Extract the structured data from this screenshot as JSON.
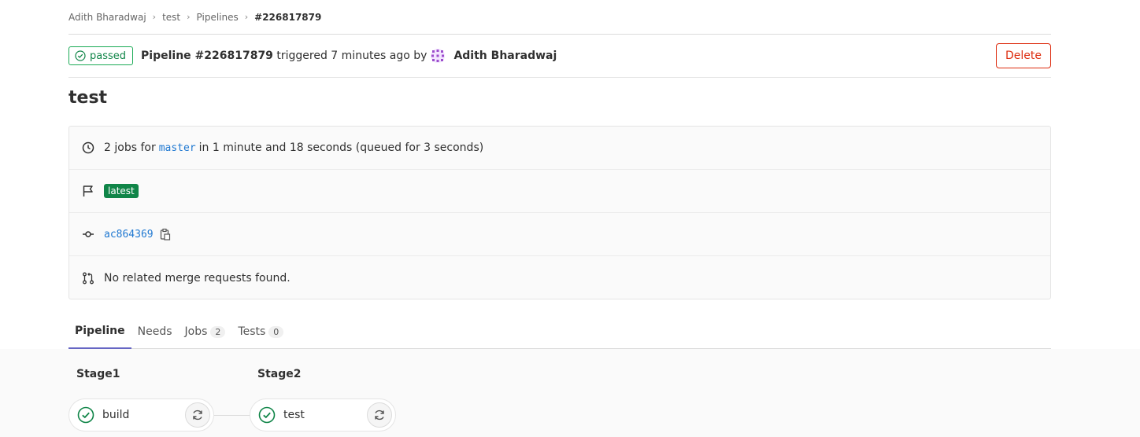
{
  "breadcrumb": [
    {
      "label": "Adith Bharadwaj"
    },
    {
      "label": "test"
    },
    {
      "label": "Pipelines"
    },
    {
      "label": "#226817879"
    }
  ],
  "header": {
    "status": "passed",
    "pipeline_label": "Pipeline #226817879",
    "triggered_text": "triggered 7 minutes ago by",
    "author": "Adith Bharadwaj",
    "delete_label": "Delete"
  },
  "title": "test",
  "info": {
    "jobs_prefix": "2 jobs for",
    "branch": "master",
    "jobs_suffix": "in 1 minute and 18 seconds (queued for 3 seconds)",
    "tag": "latest",
    "commit_sha": "ac864369",
    "merge_requests": "No related merge requests found."
  },
  "tabs": [
    {
      "label": "Pipeline",
      "count": null,
      "active": true
    },
    {
      "label": "Needs",
      "count": null,
      "active": false
    },
    {
      "label": "Jobs",
      "count": "2",
      "active": false
    },
    {
      "label": "Tests",
      "count": "0",
      "active": false
    }
  ],
  "stages": [
    {
      "name": "Stage1",
      "job": "build"
    },
    {
      "name": "Stage2",
      "job": "test"
    }
  ],
  "colors": {
    "success": "#108548",
    "danger": "#dd2b0e",
    "link": "#1f78d1",
    "tab_active": "#6666c4"
  }
}
